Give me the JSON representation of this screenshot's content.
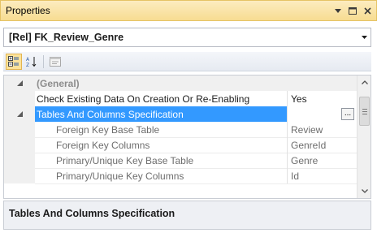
{
  "window": {
    "title": "Properties"
  },
  "selector": {
    "value": "[Rel] FK_Review_Genre"
  },
  "toolbar": {
    "buttons": [
      {
        "name": "categorized-icon",
        "active": true
      },
      {
        "name": "alphabetical-icon",
        "active": false
      },
      {
        "name": "property-pages-icon",
        "active": false
      }
    ]
  },
  "grid": {
    "rows": [
      {
        "name": "(General)",
        "value": "",
        "type": "category"
      },
      {
        "name": "Check Existing Data On Creation Or Re-Enabling",
        "value": "Yes",
        "type": "property"
      },
      {
        "name": "Tables And Columns Specification",
        "value": "",
        "type": "selected",
        "value_button": "..."
      },
      {
        "name": "Foreign Key Base Table",
        "value": "Review",
        "type": "child"
      },
      {
        "name": "Foreign Key Columns",
        "value": "GenreId",
        "type": "child"
      },
      {
        "name": "Primary/Unique Key Base Table",
        "value": "Genre",
        "type": "child"
      },
      {
        "name": "Primary/Unique Key Columns",
        "value": "Id",
        "type": "child"
      }
    ]
  },
  "description": {
    "title": "Tables And Columns Specification"
  },
  "colors": {
    "title_bar": "#f7dc91",
    "selection": "#3399ff",
    "category_bg": "#f0f0f0"
  }
}
